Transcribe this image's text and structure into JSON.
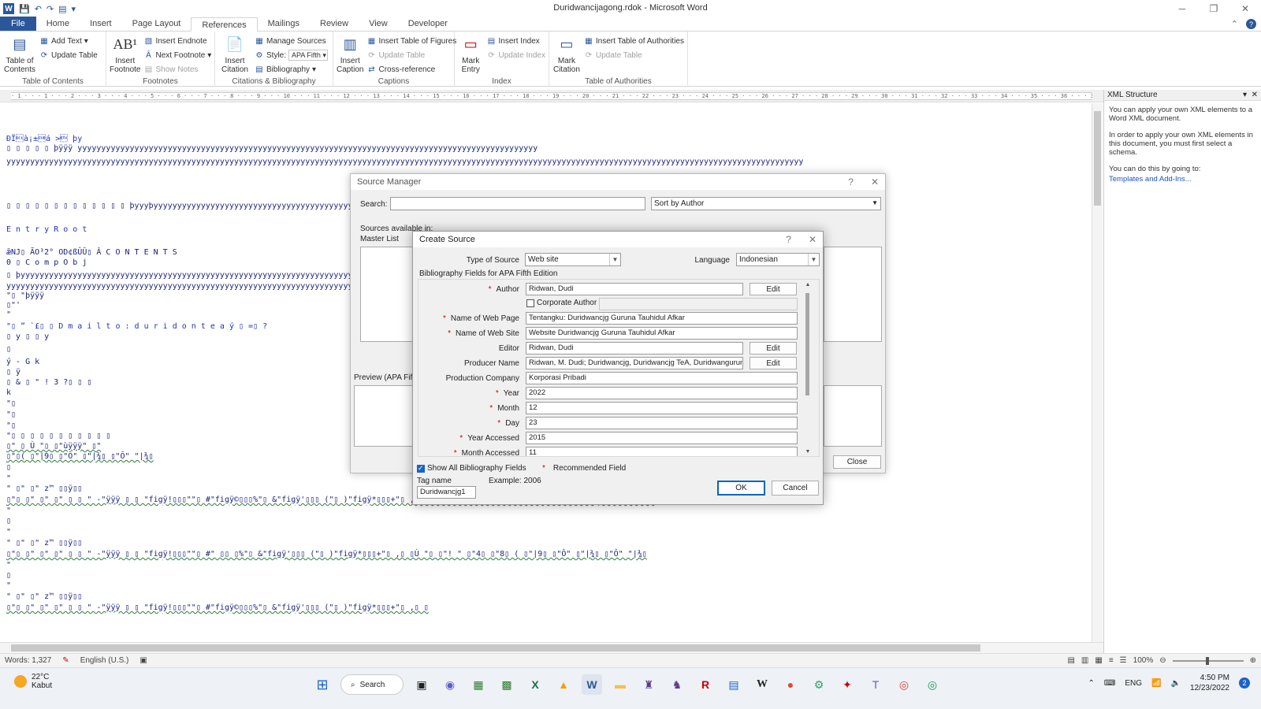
{
  "window": {
    "title": "Duridwancijagong.rdok - Microsoft Word"
  },
  "tabs": [
    "File",
    "Home",
    "Insert",
    "Page Layout",
    "References",
    "Mailings",
    "Review",
    "View",
    "Developer"
  ],
  "ribbon": {
    "toc": {
      "big": "Table of Contents",
      "add_text": "Add Text",
      "update_table": "Update Table",
      "label": "Table of Contents"
    },
    "footnotes": {
      "big": "Insert Footnote",
      "insert_endnote": "Insert Endnote",
      "next_footnote": "Next Footnote",
      "show_notes": "Show Notes",
      "label": "Footnotes"
    },
    "citations": {
      "big": "Insert Citation",
      "manage_sources": "Manage Sources",
      "style_label": "Style:",
      "style_value": "APA Fifth",
      "bibliography": "Bibliography",
      "label": "Citations & Bibliography"
    },
    "captions": {
      "big": "Insert Caption",
      "insert_tof": "Insert Table of Figures",
      "update_table": "Update Table",
      "cross_reference": "Cross-reference",
      "label": "Captions"
    },
    "index": {
      "big": "Mark Entry",
      "insert_index": "Insert Index",
      "update_index": "Update Index",
      "label": "Index"
    },
    "toa": {
      "big": "Mark Citation",
      "insert_toa": "Insert Table of Authorities",
      "update_table": "Update Table",
      "label": "Table of Authorities"
    }
  },
  "xml_pane": {
    "title": "XML Structure",
    "p1": "You can apply your own XML elements to a Word XML document.",
    "p2": "In order to apply your own XML elements in this document, you must first select a schema.",
    "p3": "You can do this by going to:",
    "link": "Templates and Add-Ins..."
  },
  "source_manager": {
    "title": "Source Manager",
    "search_label": "Search:",
    "sort_value": "Sort by Author",
    "sources_available": "Sources available in:",
    "master_list": "Master List",
    "preview_label": "Preview (APA Fifth",
    "close": "Close"
  },
  "create_source": {
    "title": "Create Source",
    "type_label": "Type of Source",
    "type_value": "Web site",
    "language_label": "Language",
    "language_value": "Indonesian",
    "group_label": "Bibliography Fields for APA Fifth Edition",
    "fields": {
      "author": {
        "label": "Author",
        "value": "Ridwan, Dudi"
      },
      "corporate_author": {
        "label": "Corporate Author"
      },
      "web_page": {
        "label": "Name of Web Page",
        "value": "Tentangku: Duridwancjg Guruna Tauhidul Afkar"
      },
      "web_site": {
        "label": "Name of Web Site",
        "value": "Website Duridwancjg Guruna Tauhidul Afkar"
      },
      "editor": {
        "label": "Editor",
        "value": "Ridwan, Dudi"
      },
      "producer": {
        "label": "Producer Name",
        "value": "Ridwan, M. Dudi; Duridwancjg, Duridwancjg TeA, Duridwangurunataf"
      },
      "production_company": {
        "label": "Production Company",
        "value": "Korporasi Pribadi"
      },
      "year": {
        "label": "Year",
        "value": "2022"
      },
      "month": {
        "label": "Month",
        "value": "12"
      },
      "day": {
        "label": "Day",
        "value": "23"
      },
      "year_accessed": {
        "label": "Year Accessed",
        "value": "2015"
      },
      "month_accessed": {
        "label": "Month Accessed",
        "value": "11"
      }
    },
    "edit": "Edit",
    "show_all": "Show All Bibliography Fields",
    "recommended": "Recommended Field",
    "tag_label": "Tag name",
    "example": "Example: 2006",
    "tag_value": "Duridwancjg1",
    "ok": "OK",
    "cancel": "Cancel"
  },
  "status": {
    "words": "Words: 1,327",
    "language": "English (U.S.)",
    "zoom": "100%"
  },
  "taskbar": {
    "temp": "22°C",
    "weather": "Kabut",
    "search": "Search",
    "lang": "ENG",
    "time": "4:50 PM",
    "date": "12/23/2022",
    "notif": "2"
  },
  "doc_lines": [
    "ÐÏ\u0011à¡±\u001aá                >\u0003 þy",
    "       ▯              ▯        ▯       ▯      ▯     þÿÿÿ         yyyyyyyyyyyyyyyyyyyyyyyyyyyyyyyyyyyyyyyyyyyyyyyyyyyyyyyyyyyyyyyyyyyyyyyyyyyyyyyyyyyyyyyyyyyyyyyyy",
    "yyyyyyyyyyyyyyyyyyyyyyyyyyyyyyyyyyyyyyyyyyyyyyyyyyyyyyyyyyyyyyyyyyyyyyyyyyyyyyyyyyyyyyyyyyyyyyyyyyyyyyyyyyyyyyyyyyyyyyyyyyyyyyyyyyyyyyyyyyyyyyyyyyyyyyyyyyyyyyyyyyyyyyyy",
    "▯    ▯    ▯    ▯    ▯    ▯    ▯    ▯    ▯    ▯    ▯    ▯    ▯   þyyyþyyyyyyyyyyyyyyyyyyyyyyyyyyyyyyyyyyyyyyyyyyyyyyyyyyyyyyyyyyyyyyyyyyyyyyyyyyyyyyyyyyyyyyyyyyyyyyyyy",
    " E n t r y                                                                                                                                     R o o t",
    "ǣNJ▯ ÃO³2°                 OD¢ßÛÛ▯       Â           C O N T E N T S",
    "     0      ▯ C o m p O b j",
    "   ▯   þyyyyyyyyyyyyyyyyyyyyyyyyyyyyyyyyyyyyyyyyyyyyyyyyyyyyyyyyyyyyyyyyyyyyyyyyyyyyyyyyyyyyyyyyyyyyyyyyyyyyyyyyyyyyyyyyyyyyyyyyyyyyyyyyyyyyyyyyyyyyyyyyyyyyyyy",
    "yyyyyyyyyyyyyyyyyyyyyyyyyyyyyyyyyyyyyyyyyyyyyyyyyyyyyyyyyyyyyyyyyyyyyyyyyyyyyyyyyyyyyyyyyyyyyyyyyyyyyyyyyyyyyyyyyyyyyyyyyyyyyyyyyyyyyyyyyyyyyyyyyyyyyyyyyyyyyyyyyyy",
    "\"▯      \"þÿÿÿ",
    "   ▯\"'",
    "   \"",
    "   \"▯    ”        `£▯      ▯    D    m a i l t o : d u r i d o n                                                          t e a           ý ▯    =▯    ?",
    "▯               y        ▯       ▯          y",
    "   ▯",
    "           ý  -   G   k",
    "   ▯      ÿ",
    "   ▯      &    ▯    \"     !    3     ?▯   ▯     ▯",
    "   k",
    "    \"▯",
    "    \"▯",
    "    \"▯",
    "    \"▯      ▯     ▯      ▯      ▯       ▯       ▯       ▯       ▯                   ▯         ▯",
    "      ▯\"      ▯     Ù      \"▯    ▯\"ùÿÿÿ\"      ▯\"",
    "▯\"▯( ▯\"|9▯ ▯\"Ô\"   ▯\"|¾▯ ▯\"Ô\"      \"|¾▯",
    "▯",
    "\"",
    "   \"     ▯\"     ▯\" z™ ▯▯ÿ▯▯",
    "▯\"▯     ▯\"      ▯\"        ▯\"        ▯ ▯     \"    -\"ÿÿÿ ▯ ▯  \"figÿ!▯▯▯\"\"▯     #\"figÿ©▯▯▯%\"▯     &\"figÿ'▯▯▯ (\"▯     )\"figÿ*▯▯▯+\"▯     ,▯ ▯Ù      \"▯     ▯\" ▯     \"        ▯\"      ▯\"8▯ ( ▯\"|9▯ ▯\"Ô\"   ▯\"|¾▯ ▯\"Ô\"          \"|¾▯",
    "\"",
    "▯",
    "   \"",
    "   \"     ▯\"     ▯\" z™ ▯▯ÿ▯▯",
    "▯\"▯     ▯\"      ▯\"        ▯\"        ▯ ▯     \"    -\"ÿÿÿ ▯ ▯  \"figÿ!▯▯▯\"\"▯     #\"     ▯▯ ▯%\"▯     &\"figÿ'▯▯▯ (\"▯     )\"figÿ*▯▯▯+\"▯     ,▯ ▯Ù      \"▯     ▯\"!      \"      ▯\"4▯  ▯\"8▯ ( ▯\"|9▯ ▯\"Ô\"   ▯\"|¾▯ ▯\"Ô\"          \"|¾▯",
    "\"",
    "▯",
    "   \"",
    "   \"     ▯\"     ▯\" z™ ▯▯ÿ▯▯",
    "▯\"▯     ▯\"      ▯\"        ▯\"        ▯ ▯     \"    -\"ÿÿÿ ▯ ▯  \"figÿ!▯▯▯\"\"▯     #\"figÿ©▯▯▯%\"▯     &\"figÿ'▯▯▯ (\"▯     )\"figÿ*▯▯▯+\"▯     ,▯ ▯"
  ]
}
